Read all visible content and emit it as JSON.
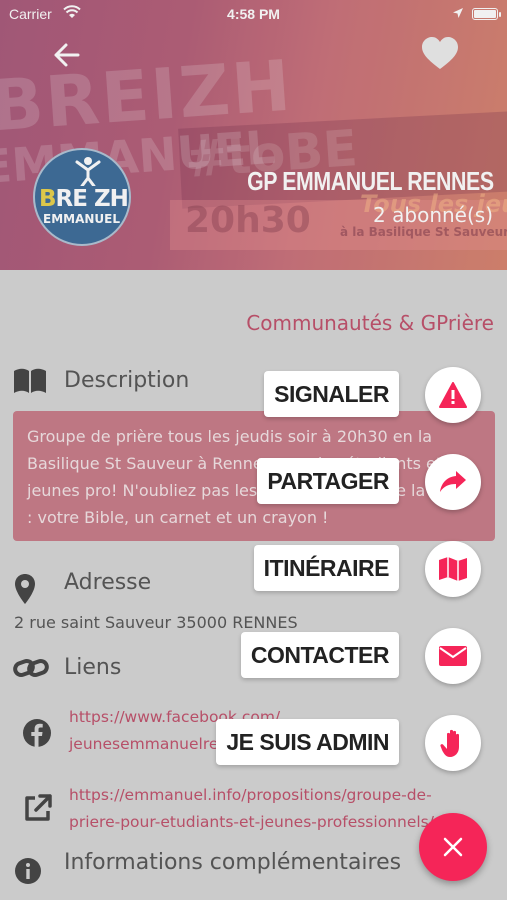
{
  "status_bar": {
    "carrier": "Carrier",
    "time": "4:58 PM"
  },
  "header": {
    "banner_texts": [
      "BREIZH",
      "EMMANUEL",
      "#toBE",
      "20h30",
      "à la Basilique St Sauveur",
      "Tous les jeudis"
    ],
    "avatar_text_1a": "B",
    "avatar_text_1b": "RE",
    "avatar_text_1c": "ZH",
    "avatar_text_2": "EMMANUEL",
    "title": "GP EMMANUEL RENNES",
    "subscribers": "2 abonné(s)"
  },
  "category": "Communautés & GPrière",
  "description": {
    "label": "Description",
    "text": "Groupe de prière tous les jeudis soir à 20h30 en la Basilique St Sauveur à Rennes pour les étudiants et jeunes pro! N'oubliez pas les indispensables de la soirée : votre Bible, un carnet et un crayon !"
  },
  "address": {
    "label": "Adresse",
    "text": "2 rue saint Sauveur 35000 RENNES"
  },
  "links": {
    "label": "Liens",
    "facebook_1": "https://www.facebook.com/",
    "facebook_2": "jeunesemmanuelrennes",
    "web_1": "https://emmanuel.info/propositions/groupe-de-",
    "web_2": "priere-pour-etudiants-et-jeunes-professionnels/"
  },
  "more_info": {
    "label": "Informations complémentaires"
  },
  "actions": [
    {
      "label": "SIGNALER",
      "icon": "warning-icon"
    },
    {
      "label": "PARTAGER",
      "icon": "share-icon"
    },
    {
      "label": "ITINÉRAIRE",
      "icon": "map-icon"
    },
    {
      "label": "CONTACTER",
      "icon": "envelope-icon"
    },
    {
      "label": "JE SUIS ADMIN",
      "icon": "hand-icon"
    }
  ],
  "colors": {
    "accent": "#f52558",
    "link": "#c0506b",
    "description_bg": "#c87b88"
  }
}
